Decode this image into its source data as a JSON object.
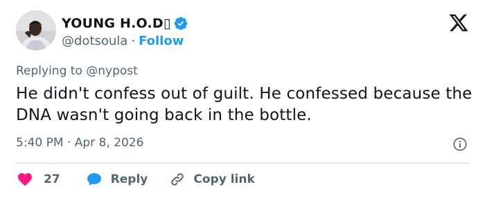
{
  "author": {
    "display_name": "YOUNG H.O.D▯",
    "handle": "@dotsoula",
    "separator": "·",
    "follow_label": "Follow"
  },
  "reply_context": {
    "prefix": "Replying to",
    "handle": "@nypost"
  },
  "tweet": {
    "text": "He didn't confess out of guilt. He confessed because the DNA wasn't going back in the bottle.",
    "time": "5:40 PM",
    "separator": "·",
    "date": "Apr 8, 2026"
  },
  "actions": {
    "like_count": "27",
    "reply_label": "Reply",
    "copy_link_label": "Copy link"
  },
  "icons": {
    "verified": "verified-badge-icon",
    "platform_logo": "x-logo-icon",
    "info": "info-icon",
    "like": "heart-icon",
    "reply": "speech-bubble-icon",
    "copy": "link-icon"
  },
  "colors": {
    "accent": "#1d9bf0",
    "like": "#f91880",
    "text": "#0f1419",
    "secondary": "#536471",
    "divider": "#cfd9de"
  }
}
